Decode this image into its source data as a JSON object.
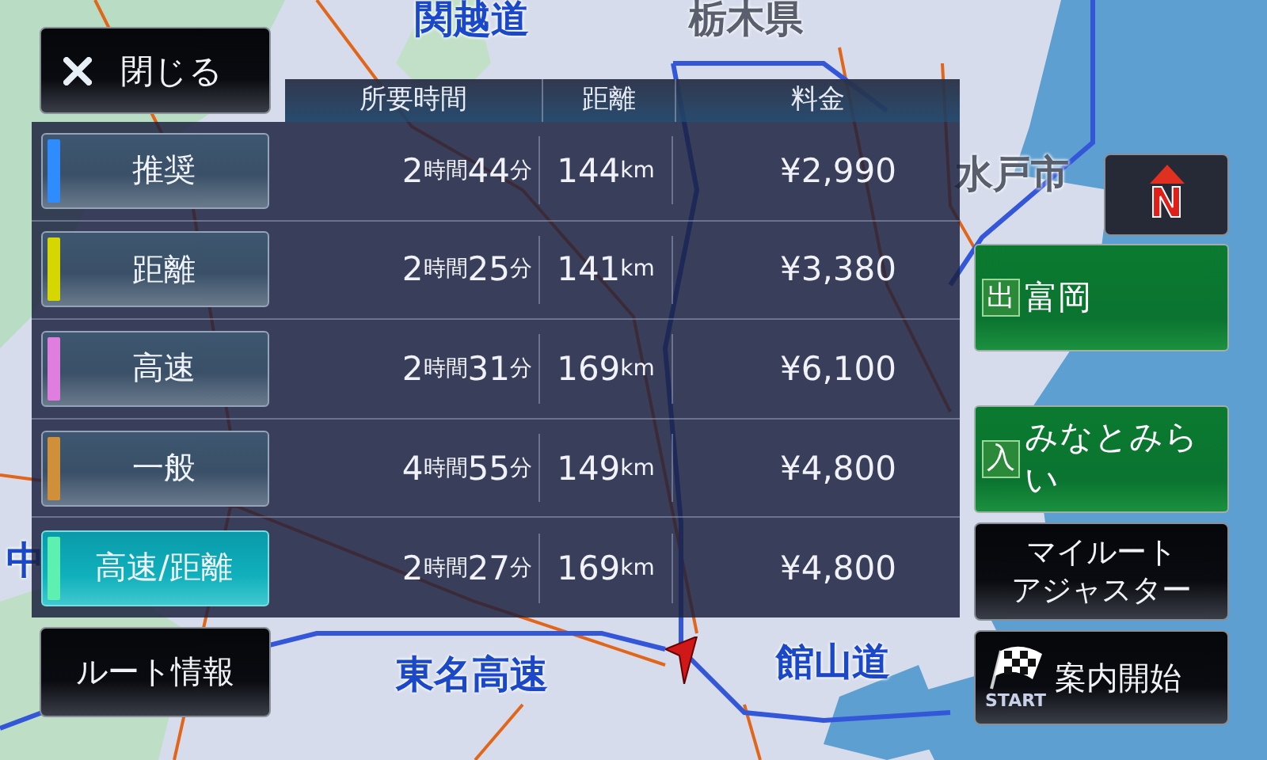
{
  "map": {
    "labels": [
      {
        "text": "関越道",
        "kind": "road"
      },
      {
        "text": "栃木県",
        "kind": "place"
      },
      {
        "text": "水戸市",
        "kind": "place"
      },
      {
        "text": "中",
        "kind": "road"
      },
      {
        "text": "東名高速",
        "kind": "road"
      },
      {
        "text": "館山道",
        "kind": "road"
      }
    ]
  },
  "close_button": {
    "label": "閉じる"
  },
  "routes": {
    "columns": [
      "所要時間",
      "距離",
      "料金"
    ],
    "rows": [
      {
        "label": "推奨",
        "color": "#2f8cff",
        "selected": false,
        "time": "2時間44分",
        "distance": "144km",
        "fee": "¥2,990"
      },
      {
        "label": "距離",
        "color": "#d6d600",
        "selected": false,
        "time": "2時間25分",
        "distance": "141km",
        "fee": "¥3,380"
      },
      {
        "label": "高速",
        "color": "#e07ee0",
        "selected": false,
        "time": "2時間31分",
        "distance": "169km",
        "fee": "¥6,100"
      },
      {
        "label": "一般",
        "color": "#d0903a",
        "selected": false,
        "time": "4時間55分",
        "distance": "149km",
        "fee": "¥4,800"
      },
      {
        "label": "高速/距離",
        "color": "#5ef0b0",
        "selected": true,
        "time": "2時間27分",
        "distance": "169km",
        "fee": "¥4,800"
      }
    ]
  },
  "route_info_button": {
    "label": "ルート情報"
  },
  "compass": {
    "letter": "N"
  },
  "signs": [
    {
      "kind": "exit",
      "badge": "出",
      "name": "富岡"
    },
    {
      "kind": "entry",
      "badge": "入",
      "name": "みなとみらい"
    }
  ],
  "my_route_button": {
    "lines": [
      "マイルート",
      "アジャスター"
    ]
  },
  "start_button": {
    "label": "案内開始",
    "flag_text": "START"
  }
}
